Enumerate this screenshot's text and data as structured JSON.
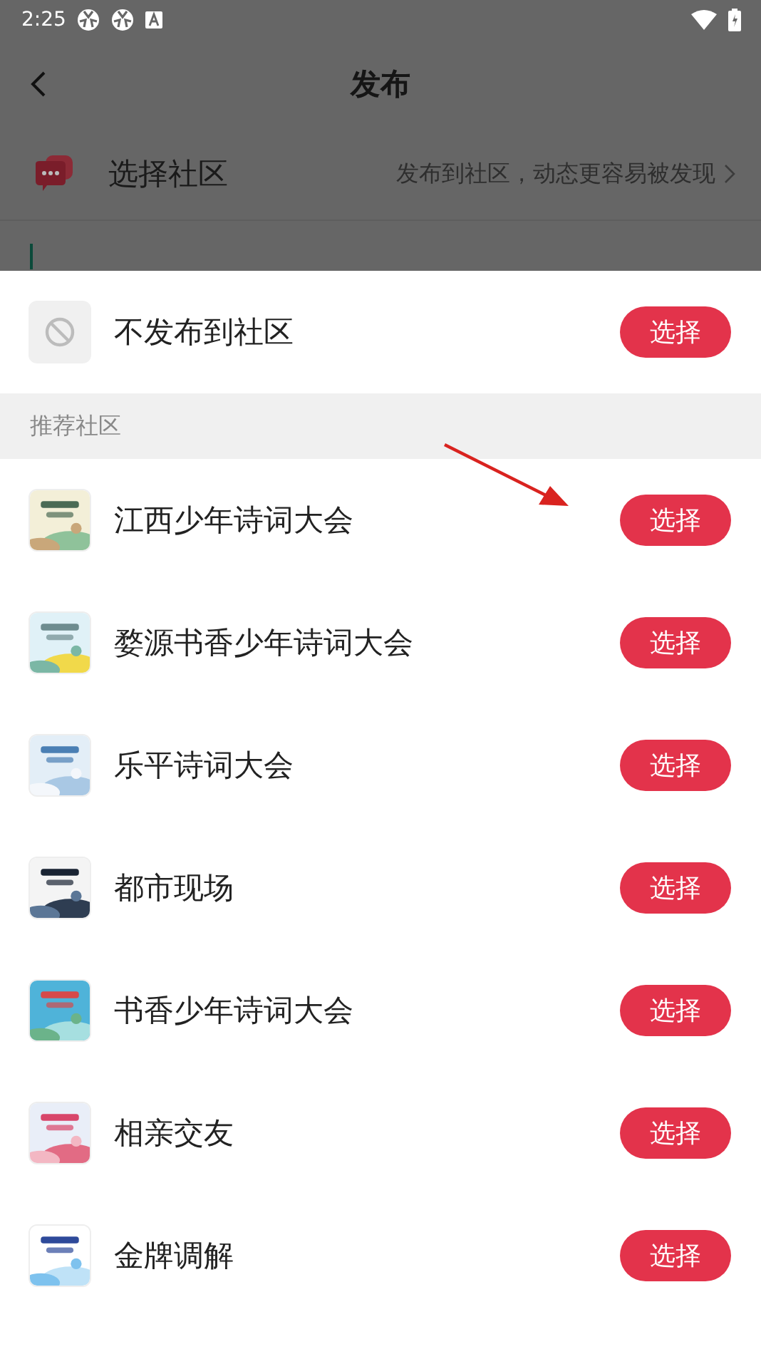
{
  "status_bar": {
    "time": "2:25"
  },
  "header": {
    "title": "发布"
  },
  "community_row": {
    "label": "选择社区",
    "hint": "发布到社区，动态更容易被发现"
  },
  "sheet": {
    "no_post": {
      "label": "不发布到社区",
      "button": "选择"
    },
    "section_title": "推荐社区",
    "communities": [
      {
        "name": "江西少年诗词大会",
        "button": "选择"
      },
      {
        "name": "婺源书香少年诗词大会",
        "button": "选择"
      },
      {
        "name": "乐平诗词大会",
        "button": "选择"
      },
      {
        "name": "都市现场",
        "button": "选择"
      },
      {
        "name": "书香少年诗词大会",
        "button": "选择"
      },
      {
        "name": "相亲交友",
        "button": "选择"
      },
      {
        "name": "金牌调解",
        "button": "选择"
      }
    ]
  }
}
